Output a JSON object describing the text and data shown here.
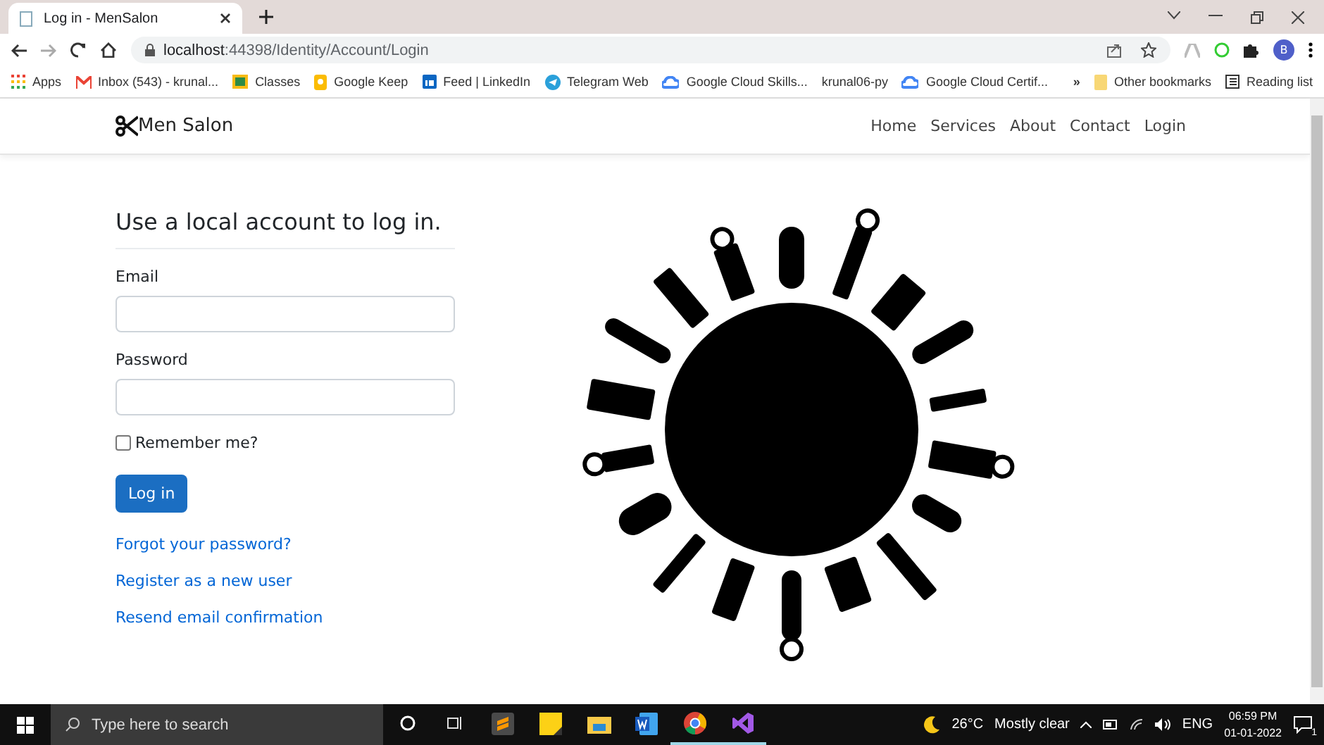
{
  "browser": {
    "tabs": [
      {
        "title": "Log in - MenSalon",
        "selected": true
      }
    ],
    "address": {
      "host": "localhost",
      "path": ":44398/Identity/Account/Login"
    },
    "profile_initial": "B",
    "bookmarks": [
      {
        "kind": "apps",
        "label": "Apps"
      },
      {
        "kind": "mail",
        "label": "Inbox (543) - krunal..."
      },
      {
        "kind": "classroom",
        "label": "Classes"
      },
      {
        "kind": "keep",
        "label": "Google Keep"
      },
      {
        "kind": "linkedin",
        "label": "Feed | LinkedIn"
      },
      {
        "kind": "telegram",
        "label": "Telegram Web"
      },
      {
        "kind": "cloud",
        "label": "Google Cloud Skills..."
      },
      {
        "kind": "none",
        "label": "krunal06-py"
      },
      {
        "kind": "cloud",
        "label": "Google Cloud Certif..."
      }
    ],
    "overflow": "»",
    "other_bookmarks": "Other bookmarks",
    "reading_list": "Reading list"
  },
  "site": {
    "brand": "Men Salon",
    "nav": [
      "Home",
      "Services",
      "About",
      "Contact",
      "Login"
    ],
    "heading": "Use a local account to log in.",
    "fields": [
      {
        "label": "Email"
      },
      {
        "label": "Password"
      }
    ],
    "remember": {
      "label": "Remember me?",
      "checked": false
    },
    "submit": "Log in",
    "links": [
      "Forgot your password?",
      "Register as a new user",
      "Resend email confirmation"
    ]
  },
  "taskbar": {
    "search_placeholder": "Type here to search",
    "apps": [
      {
        "kind": "sublime",
        "open": false
      },
      {
        "kind": "notes",
        "open": false
      },
      {
        "kind": "explorer",
        "open": false
      },
      {
        "kind": "word",
        "open": false
      },
      {
        "kind": "chrome",
        "open": true
      },
      {
        "kind": "vs",
        "open": true
      }
    ],
    "weather": "26°C",
    "weather_text": "Mostly clear",
    "language": "ENG",
    "time": "06:59 PM",
    "date": "01-01-2022",
    "notifications": "1"
  }
}
